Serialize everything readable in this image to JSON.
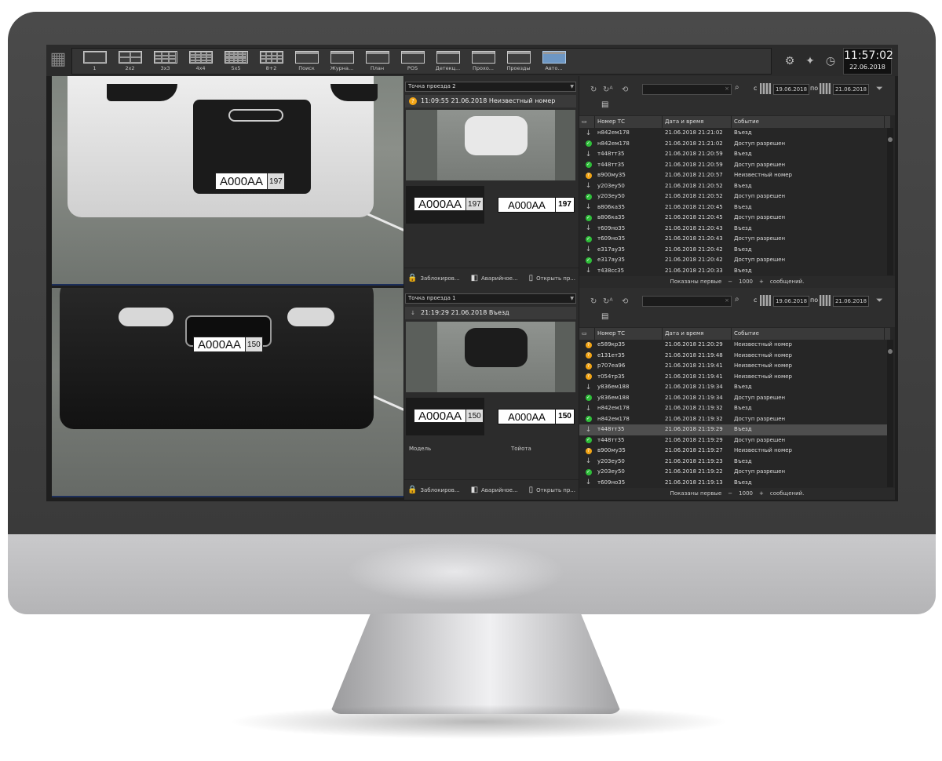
{
  "toolbar": {
    "layouts": [
      {
        "label": "1",
        "grid": "1"
      },
      {
        "label": "2x2",
        "grid": "2x2"
      },
      {
        "label": "3x3",
        "grid": "3x3"
      },
      {
        "label": "4x4",
        "grid": "4x4"
      },
      {
        "label": "5x5",
        "grid": "5x5"
      },
      {
        "label": "8+2",
        "grid": "8+2"
      },
      {
        "label": "Поиск",
        "grid": "search"
      },
      {
        "label": "Журна...",
        "grid": "journal"
      },
      {
        "label": "План",
        "grid": "plan"
      },
      {
        "label": "POS",
        "grid": "pos"
      },
      {
        "label": "Детекц...",
        "grid": "detect"
      },
      {
        "label": "Прохо...",
        "grid": "pass"
      },
      {
        "label": "Проезды",
        "grid": "drive"
      },
      {
        "label": "Авто...",
        "grid": "auto"
      }
    ],
    "active_index": 13
  },
  "clock": {
    "time": "11:57:02",
    "date": "22.06.2018"
  },
  "cameras": [
    {
      "plate_num": "А000АА",
      "plate_reg": "197"
    },
    {
      "plate_num": "А000АА",
      "plate_reg": "150"
    }
  ],
  "panels": [
    {
      "point": "Точка проезда 2",
      "event": "11:09:55 21.06.2018 Неизвестный номер",
      "event_icon": "unknown",
      "crop_plate": {
        "num": "А000АА",
        "reg": "197"
      },
      "recognized": {
        "num": "А000АА",
        "reg": "197"
      },
      "meta": null,
      "buttons": [
        "Заблокиров...",
        "Аварийное...",
        "Открыть пр..."
      ]
    },
    {
      "point": "Точка проезда 1",
      "event": "21:19:29 21.06.2018 Въезд",
      "event_icon": "entry",
      "crop_plate": {
        "num": "А000АА",
        "reg": "150"
      },
      "recognized": {
        "num": "А000АА",
        "reg": "150"
      },
      "meta": {
        "label": "Модель",
        "value": "Тойота"
      },
      "buttons": [
        "Заблокиров...",
        "Аварийное...",
        "Открыть пр..."
      ]
    }
  ],
  "journals": [
    {
      "date_from_label": "с",
      "date_from": "19.06.2018",
      "date_to_label": "по",
      "date_to": "21.06.2018",
      "search_value": "",
      "columns": [
        "Номер ТС",
        "Дата и время",
        "Событие"
      ],
      "rows": [
        {
          "icon": "entry",
          "plate": "н842ем178",
          "time": "21.06.2018 21:21:02",
          "event": "Въезд"
        },
        {
          "icon": "ok",
          "plate": "н842ем178",
          "time": "21.06.2018 21:21:02",
          "event": "Доступ разрешен"
        },
        {
          "icon": "entry",
          "plate": "т448тт35",
          "time": "21.06.2018 21:20:59",
          "event": "Въезд"
        },
        {
          "icon": "ok",
          "plate": "т448тт35",
          "time": "21.06.2018 21:20:59",
          "event": "Доступ разрешен"
        },
        {
          "icon": "unknown",
          "plate": "в900му35",
          "time": "21.06.2018 21:20:57",
          "event": "Неизвестный номер"
        },
        {
          "icon": "entry",
          "plate": "у203еу50",
          "time": "21.06.2018 21:20:52",
          "event": "Въезд"
        },
        {
          "icon": "ok",
          "plate": "у203еу50",
          "time": "21.06.2018 21:20:52",
          "event": "Доступ разрешен"
        },
        {
          "icon": "entry",
          "plate": "в806ка35",
          "time": "21.06.2018 21:20:45",
          "event": "Въезд"
        },
        {
          "icon": "ok",
          "plate": "в806ка35",
          "time": "21.06.2018 21:20:45",
          "event": "Доступ разрешен"
        },
        {
          "icon": "entry",
          "plate": "т609но35",
          "time": "21.06.2018 21:20:43",
          "event": "Въезд"
        },
        {
          "icon": "ok",
          "plate": "т609но35",
          "time": "21.06.2018 21:20:43",
          "event": "Доступ разрешен"
        },
        {
          "icon": "entry",
          "plate": "е317ау35",
          "time": "21.06.2018 21:20:42",
          "event": "Въезд"
        },
        {
          "icon": "ok",
          "plate": "е317ау35",
          "time": "21.06.2018 21:20:42",
          "event": "Доступ разрешен"
        },
        {
          "icon": "entry",
          "plate": "т438сс35",
          "time": "21.06.2018 21:20:33",
          "event": "Въезд"
        }
      ],
      "selected_row": -1,
      "footer": {
        "pre": "Показаны первые",
        "minus": "−",
        "count": "1000",
        "plus": "+",
        "post": "сообщений."
      }
    },
    {
      "date_from_label": "с",
      "date_from": "19.06.2018",
      "date_to_label": "по",
      "date_to": "21.06.2018",
      "search_value": "",
      "columns": [
        "Номер ТС",
        "Дата и время",
        "Событие"
      ],
      "rows": [
        {
          "icon": "unknown",
          "plate": "е589кр35",
          "time": "21.06.2018 21:20:29",
          "event": "Неизвестный номер"
        },
        {
          "icon": "unknown",
          "plate": "е131ет35",
          "time": "21.06.2018 21:19:48",
          "event": "Неизвестный номер"
        },
        {
          "icon": "unknown",
          "plate": "р707еа96",
          "time": "21.06.2018 21:19:41",
          "event": "Неизвестный номер"
        },
        {
          "icon": "unknown",
          "plate": "т054тр35",
          "time": "21.06.2018 21:19:41",
          "event": "Неизвестный номер"
        },
        {
          "icon": "entry",
          "plate": "у836ем188",
          "time": "21.06.2018 21:19:34",
          "event": "Въезд"
        },
        {
          "icon": "ok",
          "plate": "у836ем188",
          "time": "21.06.2018 21:19:34",
          "event": "Доступ разрешен"
        },
        {
          "icon": "entry",
          "plate": "н842ем178",
          "time": "21.06.2018 21:19:32",
          "event": "Въезд"
        },
        {
          "icon": "ok",
          "plate": "н842ем178",
          "time": "21.06.2018 21:19:32",
          "event": "Доступ разрешен"
        },
        {
          "icon": "entry",
          "plate": "т448тт35",
          "time": "21.06.2018 21:19:29",
          "event": "Въезд"
        },
        {
          "icon": "ok",
          "plate": "т448тт35",
          "time": "21.06.2018 21:19:29",
          "event": "Доступ разрешен"
        },
        {
          "icon": "unknown",
          "plate": "в900му35",
          "time": "21.06.2018 21:19:27",
          "event": "Неизвестный номер"
        },
        {
          "icon": "entry",
          "plate": "у203еу50",
          "time": "21.06.2018 21:19:23",
          "event": "Въезд"
        },
        {
          "icon": "ok",
          "plate": "у203еу50",
          "time": "21.06.2018 21:19:22",
          "event": "Доступ разрешен"
        },
        {
          "icon": "entry",
          "plate": "т609но35",
          "time": "21.06.2018 21:19:13",
          "event": "Въезд"
        }
      ],
      "selected_row": 8,
      "footer": {
        "pre": "Показаны первые",
        "minus": "−",
        "count": "1000",
        "plus": "+",
        "post": "сообщений."
      }
    }
  ],
  "icons": {
    "entry": "arrow-down-icon",
    "ok": "check-icon",
    "unknown": "question-icon"
  },
  "colors": {
    "ok": "#2fbf3a",
    "unknown": "#f2a516",
    "entry": "#9a9a9a",
    "accent": "#6d97c4"
  }
}
